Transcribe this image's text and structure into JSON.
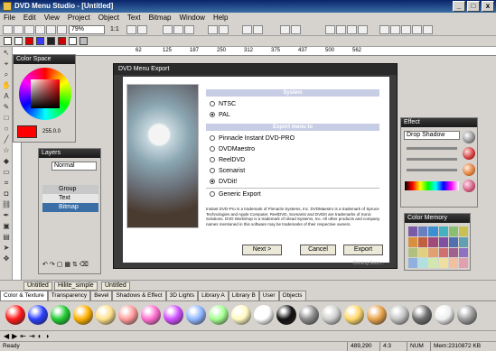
{
  "app": {
    "title": "DVD Menu Studio - [Untitled]"
  },
  "window_controls": {
    "min": "_",
    "max": "□",
    "close": "x"
  },
  "menu": [
    "File",
    "Edit",
    "View",
    "Project",
    "Object",
    "Text",
    "Bitmap",
    "Window",
    "Help"
  ],
  "toolbar": {
    "zoom": "79%",
    "ratio": "1:1"
  },
  "rulers": {
    "h_ticks": [
      "62",
      "125",
      "187",
      "250",
      "312",
      "375",
      "437",
      "500",
      "562"
    ]
  },
  "panels": {
    "color_space": {
      "title": "Color Space",
      "value": "255.0.0",
      "accent": "#ff0000"
    },
    "layers": {
      "title": "Layers",
      "blend": "Normal",
      "items": [
        "Group",
        "Text",
        "Bitmap"
      ]
    },
    "effect": {
      "title": "Effect",
      "effect_name": "Drop Shadow"
    },
    "color_memory": {
      "title": "Color Memory"
    }
  },
  "dialog": {
    "title": "DVD Menu Export",
    "system_header": "System",
    "ntsc": "NTSC",
    "pal": "PAL",
    "export_header": "Export menu to",
    "options": [
      "Pinnacle Instant DVD-PRO",
      "DVDMaestro",
      "ReelDVD",
      "Scenarist",
      "DVDit!",
      "Generic Export"
    ],
    "fine_print": "Instant DVD-Pro is a trademark of Pinnacle Systems, Inc. DVDMaestro is a trademark of Spruce Technologies and Apple Computer. ReelDVD, Scenarist and DVDit! are trademarks of Sonic Solutions. DVD Workshop is a trademark of Ulead Systems, Inc. All other products and company names mentioned in this software may be trademarks of their respective owners.",
    "next": "Next >",
    "cancel": "Cancel",
    "export": "Export",
    "footer": "Coming Soon..."
  },
  "doc_tabs": [
    "Untitled",
    "Hilite_simple",
    "Untitled"
  ],
  "palette_tabs": [
    "Color & Texture",
    "Transparency",
    "Bevel",
    "Shadows & Effect",
    "3D Lights",
    "Library A",
    "Library B",
    "User",
    "Objects"
  ],
  "palette_colors": [
    "#ff1a1a",
    "#2a3fff",
    "#22cc33",
    "#ffb000",
    "#ffe08a",
    "#ff9a9a",
    "#ff6fd0",
    "#d04fff",
    "#8fb7ff",
    "#a4ff8f",
    "#fff9c0",
    "#ffffff",
    "#111111",
    "#8a8a8a",
    "#cfcfcf",
    "#ffd86a",
    "#e7a24a",
    "#c3c3c3",
    "#6f6f6f",
    "#efefef",
    "#9c9c9c"
  ],
  "status": {
    "left": "Ready",
    "coords": "489,290",
    "ratio": "4:3",
    "num": "NUM",
    "mem": "Mem:2310872 KB"
  }
}
